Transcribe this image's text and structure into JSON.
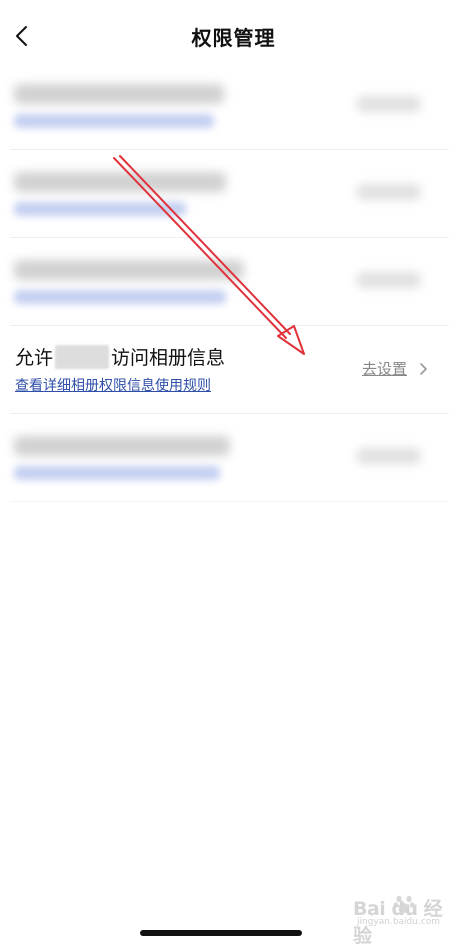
{
  "header": {
    "title": "权限管理",
    "back_icon": "chevron-left-icon"
  },
  "permission_item": {
    "title_prefix": "允许",
    "title_suffix": "访问相册信息",
    "rules_link": "查看详细相册权限信息使用规则",
    "action_label": "去设置",
    "action_icon": "chevron-right-icon"
  },
  "watermark": {
    "brand": "Bai du 经验",
    "url": "jingyan.baidu.com"
  },
  "colors": {
    "link": "#2f4fa8",
    "arrow": "#e0323a",
    "action": "#888888"
  }
}
